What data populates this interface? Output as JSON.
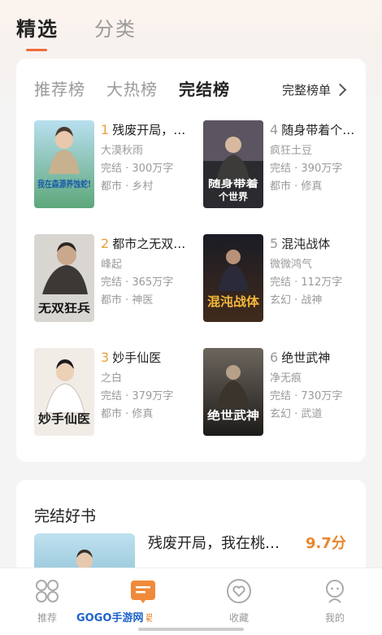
{
  "top_tabs": {
    "selected": "精选",
    "other": "分类"
  },
  "rank_tabs": {
    "items": [
      "推荐榜",
      "大热榜",
      "完结榜"
    ],
    "more": "完整榜单"
  },
  "books": [
    {
      "rank": "1",
      "title": "残废开局，…",
      "author": "大漠秋雨",
      "stats": "完结 · 300万字",
      "tags": "都市 · 乡村"
    },
    {
      "rank": "2",
      "title": "都市之无双…",
      "author": "峰起",
      "stats": "完结 · 365万字",
      "tags": "都市 · 神医"
    },
    {
      "rank": "3",
      "title": "妙手仙医",
      "author": "之白",
      "stats": "完结 · 379万字",
      "tags": "都市 · 修真"
    },
    {
      "rank": "4",
      "title": "随身带着个…",
      "author": "疯狂土豆",
      "stats": "完结 · 390万字",
      "tags": "都市 · 修真"
    },
    {
      "rank": "5",
      "title": "混沌战体",
      "author": "微微鸿气",
      "stats": "完结 · 112万字",
      "tags": "玄幻 · 战神"
    },
    {
      "rank": "6",
      "title": "绝世武神",
      "author": "净无痕",
      "stats": "完结 · 730万字",
      "tags": "玄幻 · 武道"
    }
  ],
  "covers": {
    "c1": "我在森源养蚀蛇!",
    "c2": "无双狂兵",
    "c3": "妙手仙医",
    "c4a": "随身带着",
    "c4b": "个世界",
    "c5": "混沌战体",
    "c6": "绝世武神"
  },
  "good": {
    "section_title": "完结好书",
    "book_title": "残废开局，我在桃…",
    "score": "9.7分"
  },
  "nav": [
    "推荐",
    "书架",
    "收藏",
    "我的"
  ],
  "watermark": "GOGO手游网",
  "colors": {
    "accent": "#f06a3a",
    "rank_top": "#e8a03a",
    "score": "#e8862f"
  }
}
